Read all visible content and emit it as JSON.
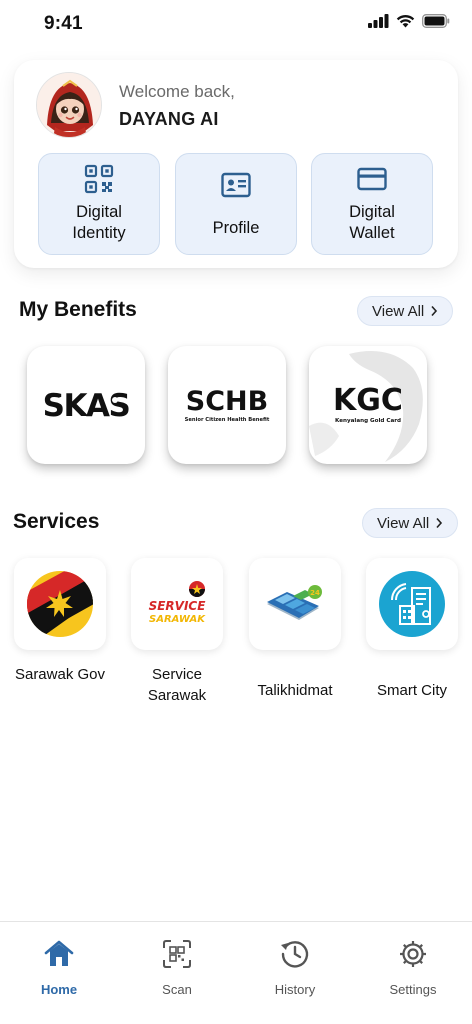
{
  "status_bar": {
    "time": "9:41"
  },
  "welcome": {
    "greeting": "Welcome back,",
    "user_name": "DAYANG AI"
  },
  "quick_actions": [
    {
      "label": "Digital Identity",
      "icon": "qr-code-icon"
    },
    {
      "label": "Profile",
      "icon": "id-card-icon"
    },
    {
      "label": "Digital Wallet",
      "icon": "card-icon"
    }
  ],
  "benefits": {
    "title": "My Benefits",
    "view_all": "View All",
    "items": [
      {
        "logo_text": "SKAS",
        "subtitle": ""
      },
      {
        "logo_text": "SCHB",
        "subtitle": "Senior Citizen Health Benefit"
      },
      {
        "logo_text": "KGC",
        "subtitle": "Kenyalang Gold Card"
      }
    ]
  },
  "services": {
    "title": "Services",
    "view_all": "View All",
    "items": [
      {
        "label": "Sarawak Gov",
        "icon": "sarawak-flag-icon"
      },
      {
        "label": "Service Sarawak",
        "icon": "service-sarawak-logo"
      },
      {
        "label": "Talikhidmat",
        "icon": "talikhidmat-logo"
      },
      {
        "label": "Smart City",
        "icon": "smart-city-icon"
      }
    ],
    "service_sarawak_logo": {
      "line1": "SERVICE",
      "line2": "SARAWAK"
    }
  },
  "bottom_nav": [
    {
      "label": "Home",
      "icon": "home-icon",
      "active": true
    },
    {
      "label": "Scan",
      "icon": "scan-icon",
      "active": false
    },
    {
      "label": "History",
      "icon": "history-icon",
      "active": false
    },
    {
      "label": "Settings",
      "icon": "gear-icon",
      "active": false
    }
  ],
  "colors": {
    "accent": "#2f6aa8",
    "quick_action_bg": "#eaf1fb",
    "icon_blue": "#2d5f8f"
  }
}
